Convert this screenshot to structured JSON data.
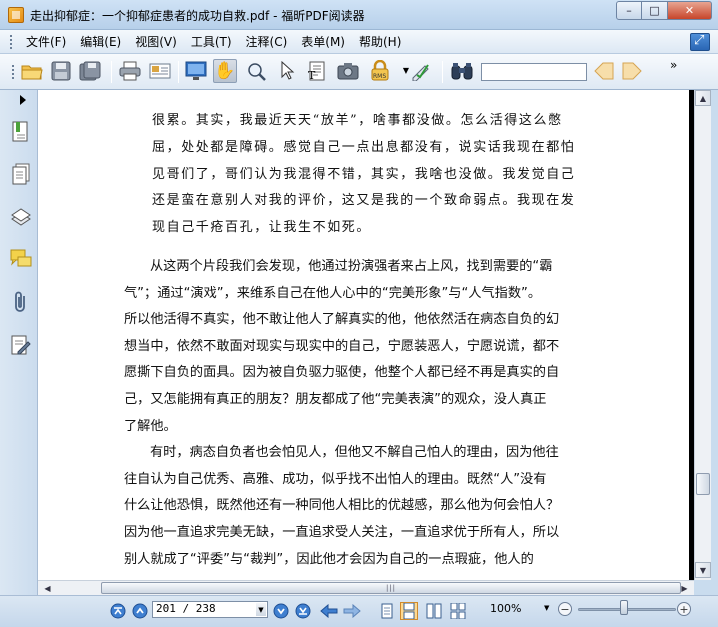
{
  "window": {
    "title": "走出抑郁症：一个抑郁症患者的成功自救.pdf - 福昕PDF阅读器",
    "minimize": "–",
    "maximize": "□",
    "close": "✕"
  },
  "menu": {
    "items": [
      {
        "label": "文件(F)"
      },
      {
        "label": "编辑(E)"
      },
      {
        "label": "视图(V)"
      },
      {
        "label": "工具(T)"
      },
      {
        "label": "注释(C)"
      },
      {
        "label": "表单(M)"
      },
      {
        "label": "帮助(H)"
      }
    ]
  },
  "toolbar": {
    "icons": [
      "open-folder-icon",
      "save-icon",
      "save-as-icon",
      "print-icon",
      "email-icon",
      "fullscreen-icon",
      "hand-tool-icon",
      "zoom-tool-icon",
      "select-arrow-icon",
      "text-select-icon",
      "snapshot-icon",
      "rms-icon",
      "sign-icon",
      "find-binoculars-icon"
    ],
    "search_value": "",
    "more": "»"
  },
  "document": {
    "quote_lines": [
      "很累。其实，我最近天天“放羊”，啥事都没做。怎么活得这么憋",
      "屈，处处都是障碍。感觉自己一点出息都没有，说实话我现在都怕",
      "见哥们了，哥们认为我混得不错，其实，我啥也没做。我发觉自己",
      "还是蛮在意别人对我的评价，这又是我的一个致命弱点。我现在发",
      "现自己千疮百孔，让我生不如死。"
    ],
    "paragraph1": [
      "从这两个片段我们会发现，他通过扮演强者来占上风，找到需要的“霸",
      "气”；通过“演戏”，来维系自己在他人心中的“完美形象”与“人气指数”。",
      "所以他活得不真实，他不敢让他人了解真实的他，他依然活在病态自负的幻",
      "想当中，依然不敢面对现实与现实中的自己，宁愿装恶人，宁愿说谎，都不",
      "愿撕下自负的面具。因为被自负驱力驱使，他整个人都已经不再是真实的自",
      "己，又怎能拥有真正的朋友？朋友都成了他“完美表演”的观众，没人真正",
      "了解他。"
    ],
    "paragraph2": [
      "有时，病态自负者也会怕见人，但他又不解自己怕人的理由，因为他往",
      "往自认为自己优秀、高雅、成功，似乎找不出怕人的理由。既然“人”没有",
      "什么让他恐惧，既然他还有一种同他人相比的优越感，那么他为何会怕人？",
      "因为他一直追求完美无缺，一直追求受人关注，一直追求优于所有人，所以",
      "别人就成了“评委”与“裁判”，因此他才会因为自己的一点瑕疵，他人的"
    ]
  },
  "scrollbar": {
    "up": "▲",
    "down": "▼",
    "left": "◀",
    "right": "▶",
    "grip": "|||"
  },
  "statusbar": {
    "page_value": "201 / 238",
    "zoom": "100%",
    "dropdown": "▼",
    "zoom_out": "−",
    "zoom_in": "+"
  }
}
